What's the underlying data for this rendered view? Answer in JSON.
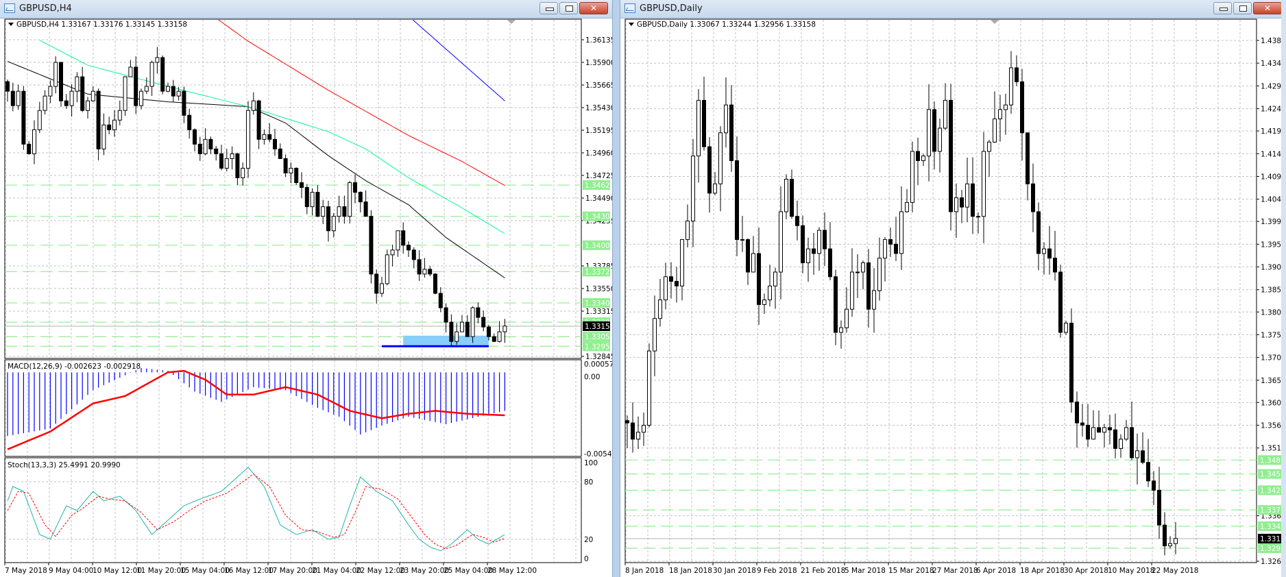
{
  "colors": {
    "level": "#90ee90",
    "grid": "#c0c0c0",
    "bid_line": "#c0c0c0",
    "macd_hist": "#0000ff",
    "macd_signal": "#ff0000",
    "stoch_main": "#20b2aa",
    "stoch_signal": "#ff0000",
    "ma_black": "#000000",
    "ma_green": "#00fa9a",
    "ma_red": "#ff0000",
    "ma_blue": "#0000ff",
    "zone_fill": "#87cefa",
    "zone_line": "#0000ff"
  },
  "left": {
    "title": "GBPUSD,H4",
    "header": "GBPUSD,H4  1.33167 1.33176 1.33145 1.33158",
    "buttons": {
      "close": "✕"
    },
    "main": {
      "ylim": [
        1.32845,
        1.36135
      ],
      "price_ticks": [
        "1.36135",
        "1.35900",
        "1.35665",
        "1.35430",
        "1.35195",
        "1.34960",
        "1.34725",
        "1.34490",
        "1.34255",
        "1.33785",
        "1.33550",
        "1.33315",
        "1.32845"
      ],
      "levels": [
        "1.34625",
        "1.34300",
        "1.34000",
        "1.33725",
        "1.33400",
        "1.33200",
        "1.33050",
        "1.32950"
      ],
      "bid": "1.33158",
      "open": 1.357,
      "closes": [
        1.356,
        1.3545,
        1.356,
        1.3505,
        1.3495,
        1.352,
        1.354,
        1.3555,
        1.3565,
        1.359,
        1.355,
        1.3545,
        1.356,
        1.3575,
        1.354,
        1.355,
        1.356,
        1.35,
        1.3525,
        1.352,
        1.353,
        1.354,
        1.3575,
        1.3585,
        1.3545,
        1.356,
        1.3565,
        1.359,
        1.3595,
        1.356,
        1.3565,
        1.3555,
        1.356,
        1.3535,
        1.352,
        1.3505,
        1.3495,
        1.351,
        1.35,
        1.3495,
        1.348,
        1.349,
        1.3495,
        1.347,
        1.348,
        1.354,
        1.355,
        1.351,
        1.3515,
        1.351,
        1.35,
        1.349,
        1.3475,
        1.348,
        1.3465,
        1.346,
        1.344,
        1.3455,
        1.343,
        1.344,
        1.3415,
        1.343,
        1.344,
        1.343,
        1.3465,
        1.3455,
        1.3445,
        1.343,
        1.337,
        1.335,
        1.336,
        1.339,
        1.3395,
        1.3415,
        1.34,
        1.3395,
        1.3385,
        1.337,
        1.3375,
        1.337,
        1.335,
        1.3335,
        1.332,
        1.33,
        1.331,
        1.332,
        1.3305,
        1.3335,
        1.3325,
        1.3315,
        1.3305,
        1.33,
        1.331,
        1.3316
      ],
      "moving_averages": [
        {
          "color": "#000000",
          "points": [
            [
              0,
              1.3591
            ],
            [
              15,
              1.3557
            ],
            [
              30,
              1.3549
            ],
            [
              45,
              1.3544
            ],
            [
              52,
              1.3527
            ],
            [
              60,
              1.3493
            ],
            [
              67,
              1.3467
            ],
            [
              75,
              1.3442
            ],
            [
              82,
              1.3408
            ],
            [
              93,
              1.3366
            ]
          ]
        },
        {
          "color": "#00fa9a",
          "points": [
            [
              6,
              1.3613
            ],
            [
              15,
              1.3587
            ],
            [
              30,
              1.3565
            ],
            [
              45,
              1.3544
            ],
            [
              60,
              1.3518
            ],
            [
              67,
              1.35
            ],
            [
              75,
              1.347
            ],
            [
              84,
              1.3442
            ],
            [
              93,
              1.3412
            ]
          ]
        },
        {
          "color": "#ff0000",
          "points": [
            [
              38,
              1.364
            ],
            [
              45,
              1.3612
            ],
            [
              60,
              1.3561
            ],
            [
              75,
              1.3514
            ],
            [
              85,
              1.3487
            ],
            [
              93,
              1.3462
            ]
          ]
        },
        {
          "color": "#0000ff",
          "points": [
            [
              74,
              1.3643
            ],
            [
              93,
              1.355
            ]
          ]
        }
      ],
      "zone": {
        "from_bar": 74,
        "to_bar": 90,
        "low": 1.3295,
        "high": 1.3306
      },
      "support_line": {
        "from_bar": 70,
        "to_bar": 90,
        "price": 1.3295
      }
    },
    "macd": {
      "label": "MACD(12,26,9) -0.002623 -0.002918",
      "ylim": [
        -0.005445,
        0.000571
      ],
      "ticks": [
        "0.000571",
        "0.00",
        "-0.005445"
      ],
      "hist_points": [
        [
          0,
          -0.0043
        ],
        [
          8,
          -0.0038
        ],
        [
          16,
          -0.0012
        ],
        [
          22,
          -0.0002
        ],
        [
          25,
          0.0003
        ],
        [
          30,
          0.0001
        ],
        [
          35,
          -0.0013
        ],
        [
          40,
          -0.002
        ],
        [
          46,
          -0.001
        ],
        [
          52,
          -0.0012
        ],
        [
          58,
          -0.0024
        ],
        [
          62,
          -0.003
        ],
        [
          66,
          -0.0042
        ],
        [
          70,
          -0.0036
        ],
        [
          75,
          -0.003
        ],
        [
          82,
          -0.0035
        ],
        [
          93,
          -0.0026
        ]
      ],
      "signal_points": [
        [
          0,
          -0.0052
        ],
        [
          8,
          -0.004
        ],
        [
          16,
          -0.0021
        ],
        [
          22,
          -0.0016
        ],
        [
          26,
          -0.0008
        ],
        [
          30,
          0.0
        ],
        [
          33,
          0.0001
        ],
        [
          37,
          -0.0005
        ],
        [
          41,
          -0.0015
        ],
        [
          46,
          -0.0015
        ],
        [
          52,
          -0.001
        ],
        [
          58,
          -0.0015
        ],
        [
          64,
          -0.0026
        ],
        [
          70,
          -0.0031
        ],
        [
          75,
          -0.0028
        ],
        [
          80,
          -0.0026
        ],
        [
          86,
          -0.0028
        ],
        [
          93,
          -0.0029
        ]
      ]
    },
    "stoch": {
      "label": "Stoch(13,3,3) 25.4991 20.9990",
      "ylim": [
        0,
        100
      ],
      "ticks": [
        "100",
        "80",
        "20",
        "0"
      ],
      "main_points": [
        [
          0,
          60
        ],
        [
          1,
          75
        ],
        [
          3,
          70
        ],
        [
          6,
          25
        ],
        [
          8,
          20
        ],
        [
          11,
          55
        ],
        [
          13,
          50
        ],
        [
          16,
          70
        ],
        [
          18,
          60
        ],
        [
          21,
          65
        ],
        [
          24,
          50
        ],
        [
          27,
          25
        ],
        [
          30,
          40
        ],
        [
          33,
          55
        ],
        [
          36,
          62
        ],
        [
          40,
          70
        ],
        [
          43,
          85
        ],
        [
          45,
          95
        ],
        [
          48,
          75
        ],
        [
          51,
          35
        ],
        [
          54,
          25
        ],
        [
          57,
          30
        ],
        [
          60,
          20
        ],
        [
          62,
          22
        ],
        [
          64,
          55
        ],
        [
          66,
          85
        ],
        [
          69,
          70
        ],
        [
          72,
          60
        ],
        [
          75,
          35
        ],
        [
          77,
          20
        ],
        [
          79,
          12
        ],
        [
          81,
          8
        ],
        [
          83,
          15
        ],
        [
          86,
          30
        ],
        [
          88,
          20
        ],
        [
          90,
          15
        ],
        [
          93,
          25
        ]
      ],
      "signal_points": [
        [
          0,
          50
        ],
        [
          2,
          70
        ],
        [
          4,
          68
        ],
        [
          7,
          35
        ],
        [
          9,
          23
        ],
        [
          12,
          45
        ],
        [
          14,
          52
        ],
        [
          17,
          65
        ],
        [
          19,
          62
        ],
        [
          22,
          60
        ],
        [
          25,
          48
        ],
        [
          28,
          30
        ],
        [
          31,
          38
        ],
        [
          34,
          50
        ],
        [
          37,
          60
        ],
        [
          41,
          68
        ],
        [
          44,
          80
        ],
        [
          46,
          88
        ],
        [
          49,
          75
        ],
        [
          52,
          45
        ],
        [
          55,
          30
        ],
        [
          58,
          28
        ],
        [
          61,
          22
        ],
        [
          63,
          25
        ],
        [
          65,
          48
        ],
        [
          67,
          75
        ],
        [
          70,
          72
        ],
        [
          73,
          62
        ],
        [
          76,
          40
        ],
        [
          78,
          25
        ],
        [
          80,
          15
        ],
        [
          82,
          10
        ],
        [
          84,
          14
        ],
        [
          87,
          25
        ],
        [
          89,
          22
        ],
        [
          91,
          17
        ],
        [
          93,
          21
        ]
      ]
    },
    "dates": [
      "7 May 2018",
      "9 May 04:00",
      "10 May 12:00",
      "11 May 20:00",
      "15 May 04:00",
      "16 May 12:00",
      "17 May 20:00",
      "21 May 04:00",
      "22 May 12:00",
      "23 May 20:00",
      "25 May 04:00",
      "28 May 12:00"
    ]
  },
  "right": {
    "title": "GBPUSD,Daily",
    "header": "GBPUSD,Daily  1.33067 1.33244 1.32956 1.33158",
    "buttons": {
      "close": "✕"
    },
    "ylim": [
      1.3267,
      1.4389
    ],
    "price_ticks": [
      "1.43890",
      "1.43400",
      "1.42910",
      "1.42420",
      "1.41940",
      "1.41450",
      "1.40960",
      "1.40470",
      "1.39990",
      "1.39500",
      "1.39010",
      "1.38520",
      "1.38040",
      "1.37550",
      "1.37060",
      "1.36570",
      "1.36090",
      "1.35600",
      "1.35110",
      "1.33650",
      "1.32670"
    ],
    "levels": [
      "1.34850",
      "1.34550",
      "1.34200",
      "1.33775",
      "1.33425",
      "1.32950"
    ],
    "bid": "1.33158",
    "open": 1.357,
    "closes": [
      1.3565,
      1.353,
      1.3545,
      1.356,
      1.372,
      1.379,
      1.383,
      1.388,
      1.387,
      1.386,
      1.396,
      1.4,
      1.414,
      1.426,
      1.416,
      1.406,
      1.408,
      1.419,
      1.425,
      1.413,
      1.396,
      1.396,
      1.389,
      1.393,
      1.382,
      1.383,
      1.386,
      1.389,
      1.402,
      1.409,
      1.401,
      1.399,
      1.391,
      1.394,
      1.393,
      1.398,
      1.394,
      1.388,
      1.376,
      1.377,
      1.381,
      1.389,
      1.389,
      1.391,
      1.381,
      1.385,
      1.392,
      1.396,
      1.395,
      1.393,
      1.402,
      1.404,
      1.415,
      1.413,
      1.414,
      1.424,
      1.415,
      1.42,
      1.426,
      1.402,
      1.405,
      1.403,
      1.408,
      1.401,
      1.401,
      1.415,
      1.417,
      1.422,
      1.424,
      1.425,
      1.433,
      1.43,
      1.419,
      1.408,
      1.402,
      1.393,
      1.394,
      1.392,
      1.389,
      1.376,
      1.378,
      1.361,
      1.3565,
      1.356,
      1.353,
      1.3555,
      1.3545,
      1.3555,
      1.355,
      1.351,
      1.353,
      1.3555,
      1.349,
      1.3505,
      1.348,
      1.344,
      1.342,
      1.3345,
      1.33,
      1.3305,
      1.3316
    ],
    "dates": [
      "8 Jan 2018",
      "18 Jan 2018",
      "30 Jan 2018",
      "9 Feb 2018",
      "21 Feb 2018",
      "5 Mar 2018",
      "15 Mar 2018",
      "27 Mar 2018",
      "6 Apr 2018",
      "18 Apr 2018",
      "30 Apr 2018",
      "10 May 2018",
      "22 May 2018"
    ]
  }
}
